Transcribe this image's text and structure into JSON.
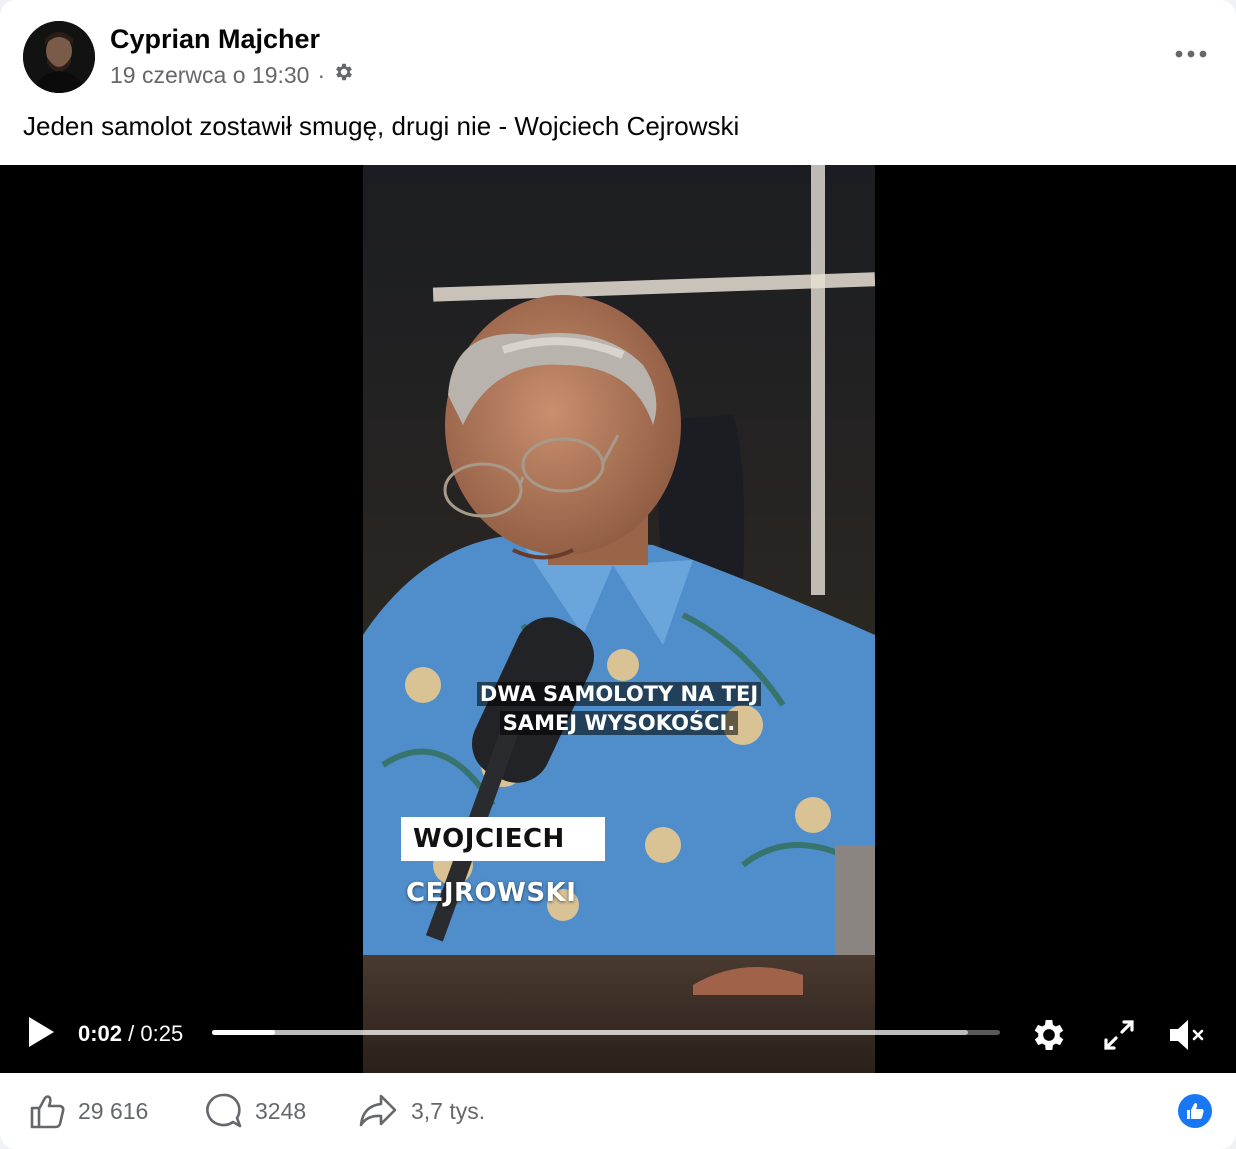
{
  "post": {
    "author": "Cyprian Majcher",
    "timestamp": "19 czerwca o 19:30",
    "separator": "·",
    "audience_icon": "gear-icon",
    "text": "Jeden samolot zostawił smugę, drugi nie - Wojciech Cejrowski"
  },
  "video": {
    "caption_line1": "DWA SAMOLOTY NA TEJ",
    "caption_line2": "SAMEJ WYSOKOŚCI.",
    "name_line1": "WOJCIECH",
    "name_line2": "CEJROWSKI",
    "current_time": "0:02",
    "time_separator": " / ",
    "duration": "0:25",
    "progress_played_fraction": 0.08,
    "progress_buffered_fraction": 0.96,
    "icons": [
      "play-icon",
      "settings-gear-icon",
      "fullscreen-icon",
      "mute-icon"
    ]
  },
  "stats": {
    "likes": "29 616",
    "comments": "3248",
    "shares": "3,7 tys."
  },
  "colors": {
    "accent": "#1877f2",
    "muted_text": "#65676b"
  }
}
